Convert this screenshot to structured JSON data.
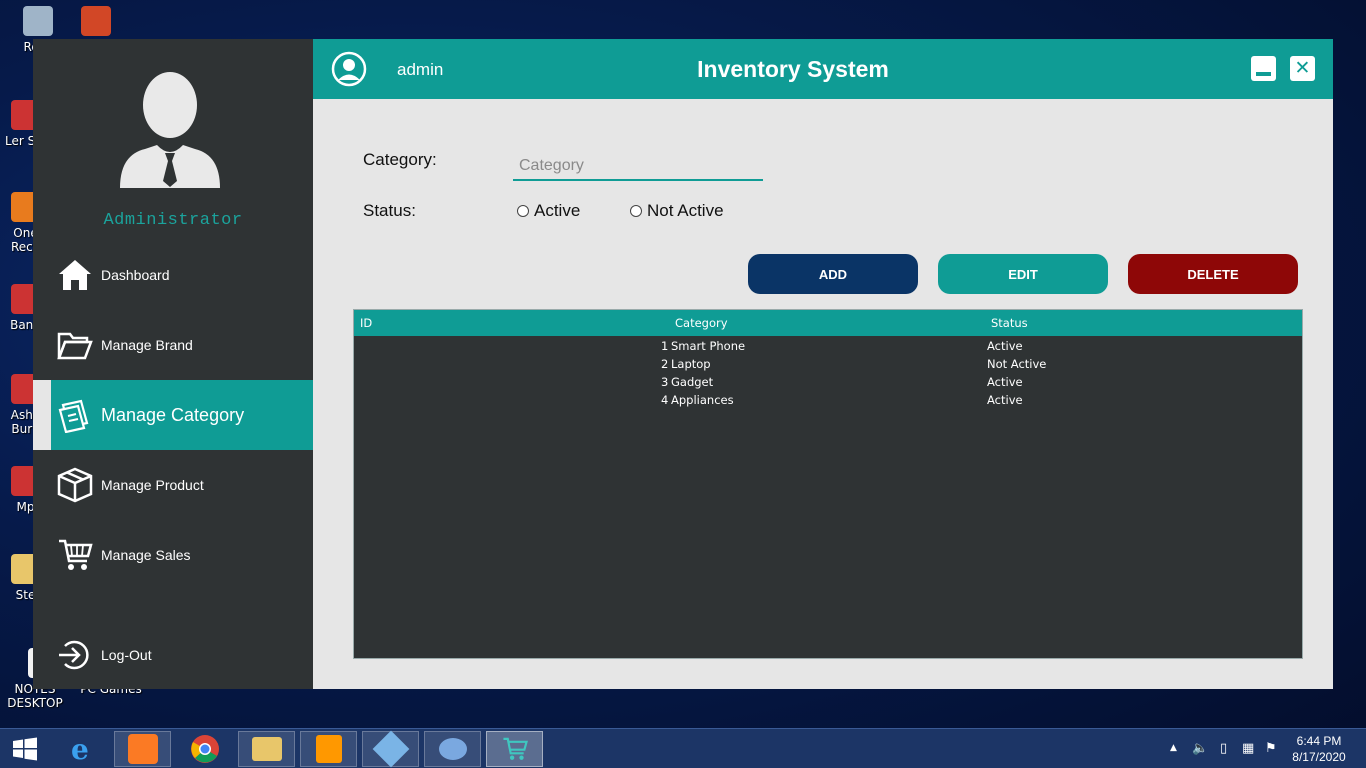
{
  "desktop": {
    "icons": [
      {
        "label": "Recy"
      },
      {
        "label": "Ler Sol"
      },
      {
        "label": "One Reco"
      },
      {
        "label": "Band"
      },
      {
        "label": "Asha Burn"
      },
      {
        "label": "Mp"
      },
      {
        "label": "Ste"
      },
      {
        "label": "NOTES DESKTOP"
      },
      {
        "label": "PC Games"
      }
    ]
  },
  "sidebar": {
    "role": "Administrator",
    "items": [
      {
        "label": "Dashboard",
        "icon": "home-icon"
      },
      {
        "label": "Manage Brand",
        "icon": "folder-icon"
      },
      {
        "label": "Manage Category",
        "icon": "category-icon"
      },
      {
        "label": "Manage Product",
        "icon": "box-icon"
      },
      {
        "label": "Manage Sales",
        "icon": "cart-icon"
      },
      {
        "label": "Log-Out",
        "icon": "logout-icon"
      }
    ],
    "active_index": 2
  },
  "header": {
    "user": "admin",
    "title": "Inventory System",
    "close_symbol": "✕"
  },
  "form": {
    "category_label": "Category:",
    "category_placeholder": "Category",
    "category_value": "",
    "status_label": "Status:",
    "status_options": [
      "Active",
      "Not Active"
    ]
  },
  "buttons": {
    "add": "ADD",
    "edit": "EDIT",
    "delete": "DELETE"
  },
  "table": {
    "columns": [
      "ID",
      "Category",
      "Status"
    ],
    "rows": [
      {
        "id": "1",
        "category": "Smart Phone",
        "status": "Active"
      },
      {
        "id": "2",
        "category": "Laptop",
        "status": "Not Active"
      },
      {
        "id": "3",
        "category": "Gadget",
        "status": "Active"
      },
      {
        "id": "4",
        "category": "Appliances",
        "status": "Active"
      }
    ]
  },
  "taskbar": {
    "time": "6:44 PM",
    "date": "8/17/2020"
  },
  "colors": {
    "accent": "#0f9c95",
    "sidebar": "#2f3334",
    "add": "#0a3466",
    "delete": "#8e0707"
  }
}
